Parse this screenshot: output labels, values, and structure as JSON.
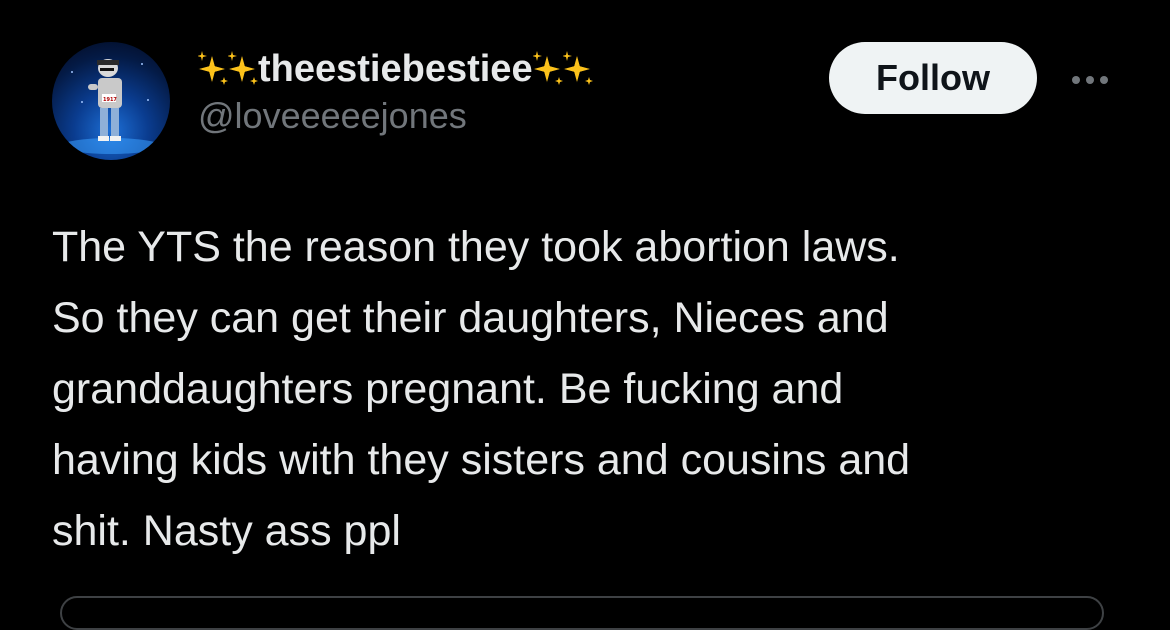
{
  "post": {
    "author": {
      "display_name": "theestiebestiee",
      "name_emoji": "sparkles",
      "handle": "@loveeeeejones",
      "avatar_badge": "1917"
    },
    "follow_label": "Follow",
    "more_icon": "more-horizontal-icon",
    "text_lines": [
      "The YTS the reason they took abortion laws.",
      "So they can get their daughters, Nieces and",
      "granddaughters pregnant. Be fucking and",
      "having kids with they sisters and cousins and",
      "shit. Nasty ass ppl"
    ]
  },
  "colors": {
    "background": "#000000",
    "text_primary": "#e7e9ea",
    "text_secondary": "#71767b",
    "follow_bg": "#eff3f4",
    "follow_text": "#0f1419",
    "sparkle": "#fcc21b"
  }
}
